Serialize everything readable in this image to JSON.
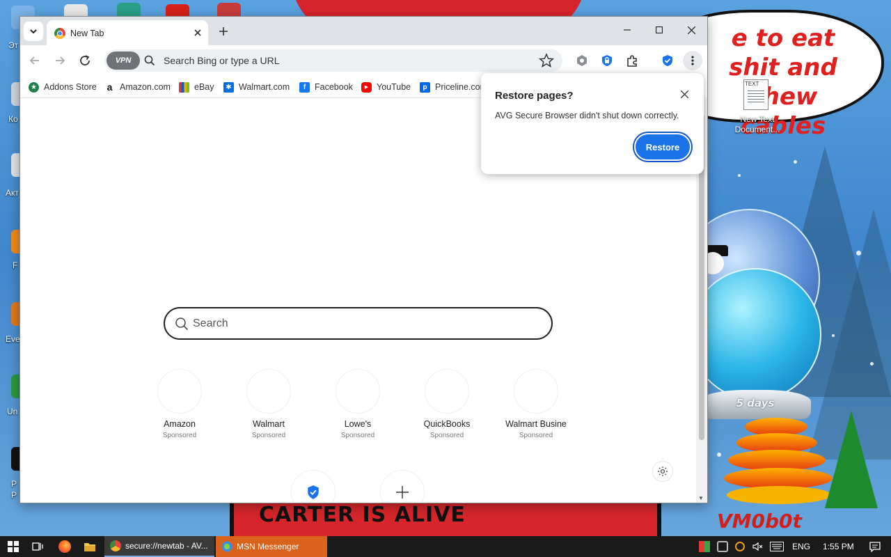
{
  "desktop": {
    "speech_text": "e to eat shit and chew cables",
    "banner_text": "CARTER IS ALIVE",
    "globe_label": "5 days",
    "watermark": "VM0b0t",
    "text_file": {
      "tag": "TEXT",
      "caption": "New Text Document..."
    },
    "icon_captions": [
      "Эт",
      "Ко",
      "Акт",
      "F",
      "Eve",
      "Un",
      "P",
      "P"
    ]
  },
  "browser": {
    "tab": {
      "title": "New Tab"
    },
    "omnibox": {
      "vpn_label": "VPN",
      "placeholder": "Search Bing or type a URL"
    },
    "bookmarks": [
      {
        "label": "Addons Store",
        "icon": "addons-icon",
        "color": "#1e7e4c"
      },
      {
        "label": "Amazon.com",
        "icon": "amazon-icon",
        "color": "#111111"
      },
      {
        "label": "eBay",
        "icon": "ebay-icon",
        "color": "#e53238"
      },
      {
        "label": "Walmart.com",
        "icon": "walmart-icon",
        "color": "#0071dc"
      },
      {
        "label": "Facebook",
        "icon": "facebook-icon",
        "color": "#1877f2"
      },
      {
        "label": "YouTube",
        "icon": "youtube-icon",
        "color": "#ff0000"
      },
      {
        "label": "Priceline.com",
        "icon": "priceline-icon",
        "color": "#0068ef"
      }
    ],
    "search": {
      "placeholder": "Search"
    },
    "tiles": [
      {
        "name": "Amazon",
        "sub": "Sponsored"
      },
      {
        "name": "Walmart",
        "sub": "Sponsored"
      },
      {
        "name": "Lowe's",
        "sub": "Sponsored"
      },
      {
        "name": "QuickBooks",
        "sub": "Sponsored"
      },
      {
        "name": "Walmart Busine",
        "sub": "Sponsored"
      }
    ],
    "popup": {
      "title": "Restore pages?",
      "message": "AVG Secure Browser didn't shut down correctly.",
      "button": "Restore"
    }
  },
  "taskbar": {
    "tasks": [
      {
        "label": "secure://newtab - AV..."
      },
      {
        "label": "MSN Messenger"
      }
    ],
    "language": "ENG",
    "time": "1:55 PM"
  },
  "colors": {
    "accent": "#1a73e8",
    "banner_red": "#d6262b",
    "taskbar_bg": "#1a1a1a",
    "msn_task_bg": "#d9631c"
  }
}
